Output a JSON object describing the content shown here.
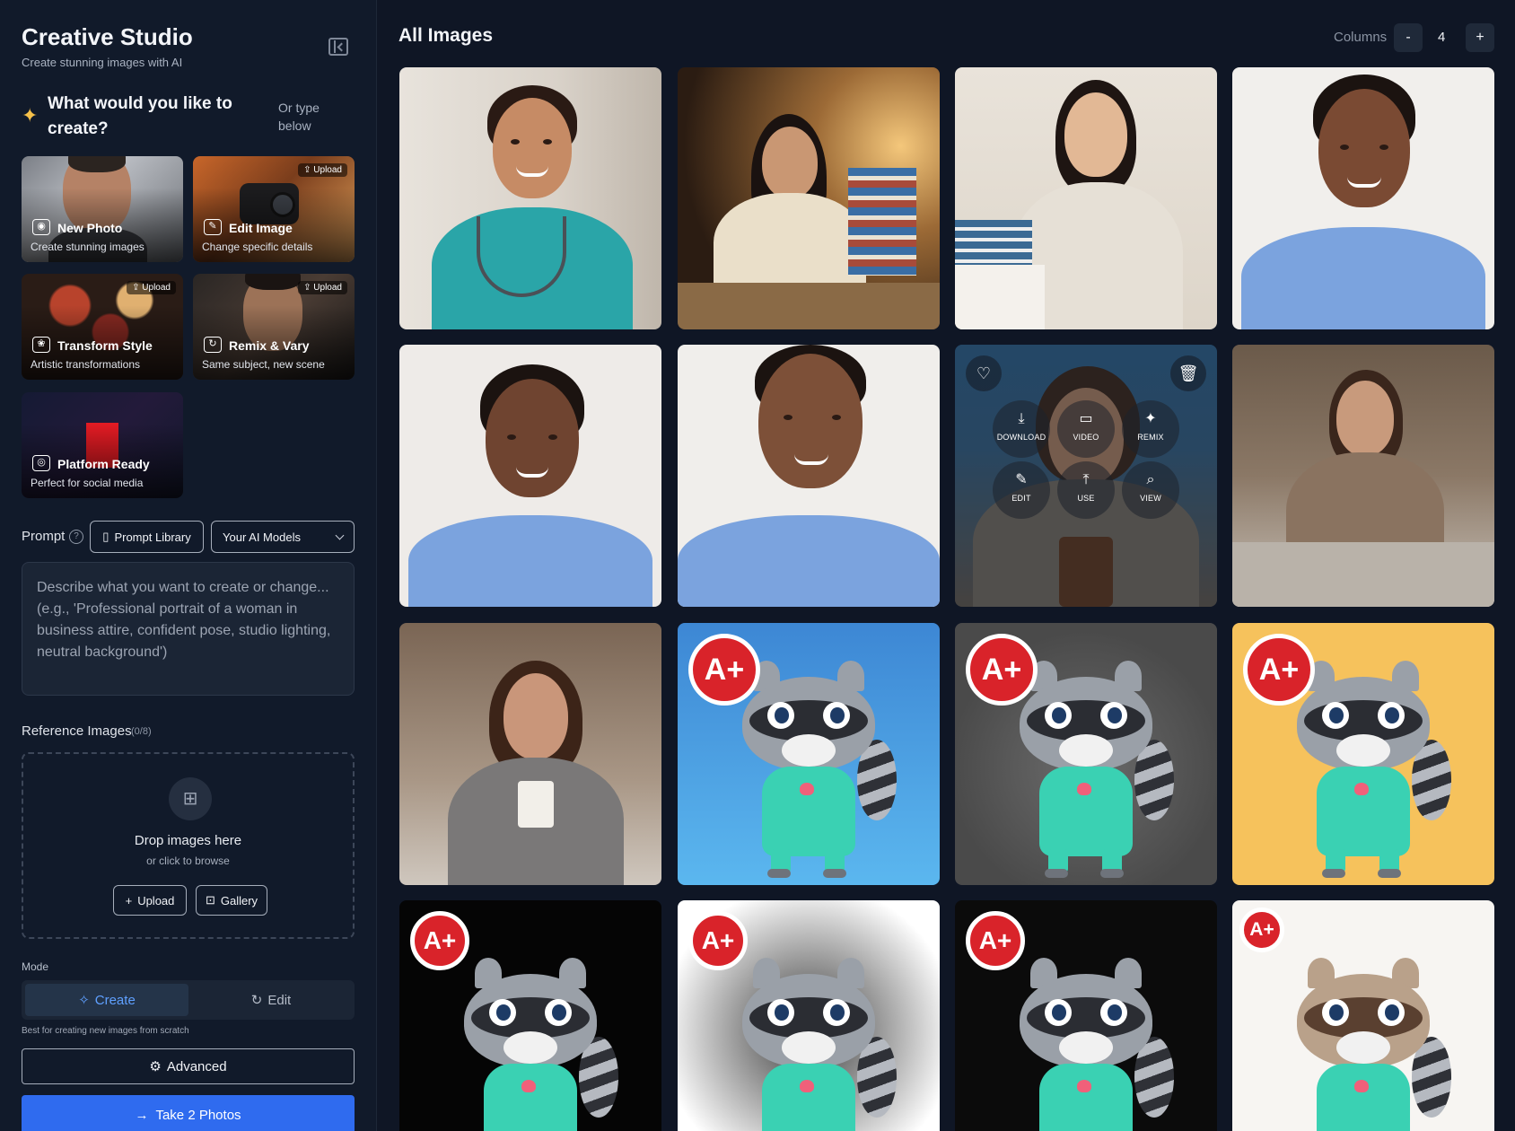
{
  "sidebar": {
    "title": "Creative Studio",
    "subtitle": "Create stunning images with AI",
    "question": "What would you like to create?",
    "or_type": "Or type below",
    "cards": [
      {
        "title": "New Photo",
        "subtitle": "Create stunning images",
        "icon": "camera-icon",
        "upload": ""
      },
      {
        "title": "Edit Image",
        "subtitle": "Change specific details",
        "icon": "pencil-icon",
        "upload": "Upload"
      },
      {
        "title": "Transform Style",
        "subtitle": "Artistic transformations",
        "icon": "palette-icon",
        "upload": "Upload"
      },
      {
        "title": "Remix & Vary",
        "subtitle": "Same subject, new scene",
        "icon": "refresh-icon",
        "upload": "Upload"
      },
      {
        "title": "Platform Ready",
        "subtitle": "Perfect for social media",
        "icon": "instagram-icon",
        "upload": ""
      }
    ],
    "prompt_label": "Prompt",
    "prompt_library_label": "Prompt Library",
    "models_select_value": "Your AI Models",
    "prompt_placeholder": "Describe what you want to create or change... (e.g., 'Professional portrait of a woman in business attire, confident pose, studio lighting, neutral background')",
    "reference_label": "Reference Images",
    "reference_count": "(0/8)",
    "drop_title": "Drop images here",
    "drop_sub": "or click to browse",
    "upload_label": "Upload",
    "gallery_label": "Gallery",
    "mode_label": "Mode",
    "mode_create": "Create",
    "mode_edit": "Edit",
    "mode_hint": "Best for creating new images from scratch",
    "advanced_label": "Advanced",
    "take_label": "Take 2 Photos"
  },
  "main": {
    "title": "All Images",
    "columns_label": "Columns",
    "columns_value": "4",
    "columns_minus": "-",
    "columns_plus": "+",
    "overlay_actions": [
      {
        "label": "DOWNLOAD",
        "icon": "download-icon"
      },
      {
        "label": "VIDEO",
        "icon": "video-icon"
      },
      {
        "label": "REMIX",
        "icon": "wand-icon"
      },
      {
        "label": "EDIT",
        "icon": "edit-icon"
      },
      {
        "label": "USE",
        "icon": "upload-arrow-icon"
      },
      {
        "label": "VIEW",
        "icon": "zoom-icon"
      }
    ],
    "badge_text": "A+"
  },
  "colors": {
    "background": "#0f1625",
    "sidebar": "#111a2a",
    "accent": "#2f6bef",
    "create_active": "#5fa0ff",
    "scrubs_teal": "#2aa5a8",
    "scrubs_blue": "#7ba3de",
    "raccoon_scrubs": "#3ad1b3",
    "badge_red": "#d9232a"
  }
}
